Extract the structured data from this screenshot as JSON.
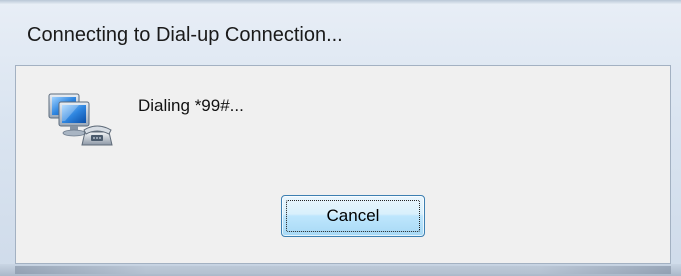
{
  "window": {
    "title": "Connecting to Dial-up Connection..."
  },
  "dialog": {
    "icon": "dial-up-connection-icon",
    "status_text": "Dialing *99#..."
  },
  "buttons": {
    "cancel_label": "Cancel"
  },
  "colors": {
    "client_background": "#f0f0f0",
    "frame_tint": "#dbe5f1",
    "button_border": "#3c7fb1",
    "button_fill": "#bee6fd"
  }
}
